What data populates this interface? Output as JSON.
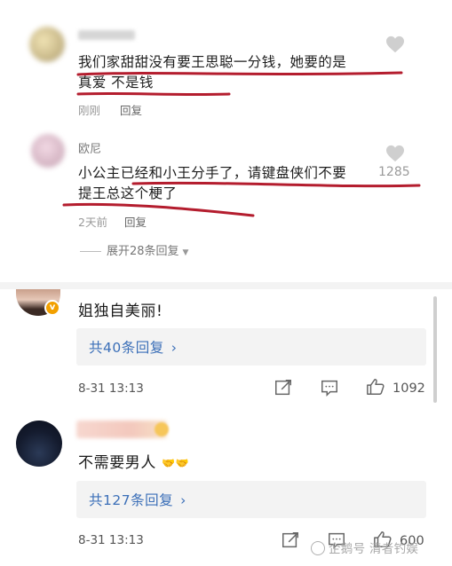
{
  "top": {
    "comment1": {
      "text_line1": "我们家甜甜没有要王思聪一分钱，她要的是",
      "text_line2": "真爱 不是钱",
      "time": "刚刚",
      "reply": "回复"
    },
    "comment2": {
      "username": "欧尼",
      "text_line1": "小公主已经和小王分手了，请键盘侠们不要",
      "text_line2": "提王总这个梗了",
      "time": "2天前",
      "reply": "回复",
      "likes": "1285"
    },
    "expand_label": "展开28条回复",
    "underline_color": "#b41d2e"
  },
  "bottom": {
    "comment1": {
      "text": "姐独自美丽!",
      "replies_link": "共40条回复",
      "time": "8-31 13:13",
      "likes": "1092",
      "badge": "v"
    },
    "comment2": {
      "text": "不需要男人",
      "emoji": "handshake-emoji",
      "replies_link": "共127条回复",
      "time": "8-31 13:13",
      "likes": "600"
    },
    "link_color": "#3b6fb8",
    "watermark": "企鹅号 清者钓娱"
  },
  "icons": {
    "like": "heart-icon",
    "share": "share-icon",
    "comment": "comment-icon",
    "thumb": "thumbs-up-icon",
    "chevron": "chevron-right-icon",
    "caret": "caret-down-icon"
  }
}
